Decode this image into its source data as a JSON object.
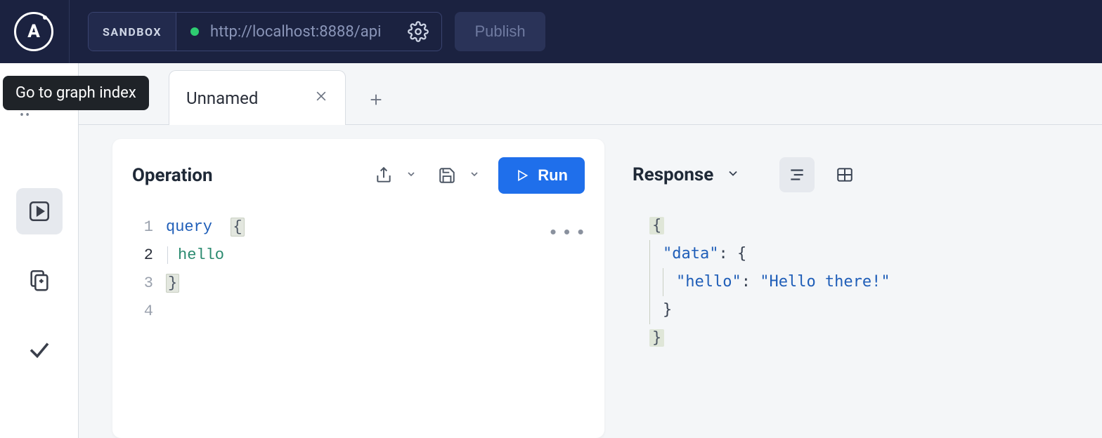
{
  "header": {
    "sandbox_label": "SANDBOX",
    "url": "http://localhost:8888/api",
    "publish_label": "Publish"
  },
  "tooltip": "Go to graph index",
  "tabs": {
    "active_label": "Unnamed"
  },
  "operation": {
    "title": "Operation",
    "run_label": "Run",
    "lines": {
      "l1_num": "1",
      "l1_kw": "query",
      "l1_brace": "{",
      "l2_num": "2",
      "l2_field": "hello",
      "l3_num": "3",
      "l3_brace": "}",
      "l4_num": "4"
    }
  },
  "response": {
    "title": "Response",
    "json": {
      "open": "{",
      "data_key": "\"data\"",
      "data_open": ": {",
      "hello_key": "\"hello\"",
      "hello_colon": ": ",
      "hello_val": "\"Hello there!\"",
      "data_close": "}",
      "close": "}"
    }
  }
}
